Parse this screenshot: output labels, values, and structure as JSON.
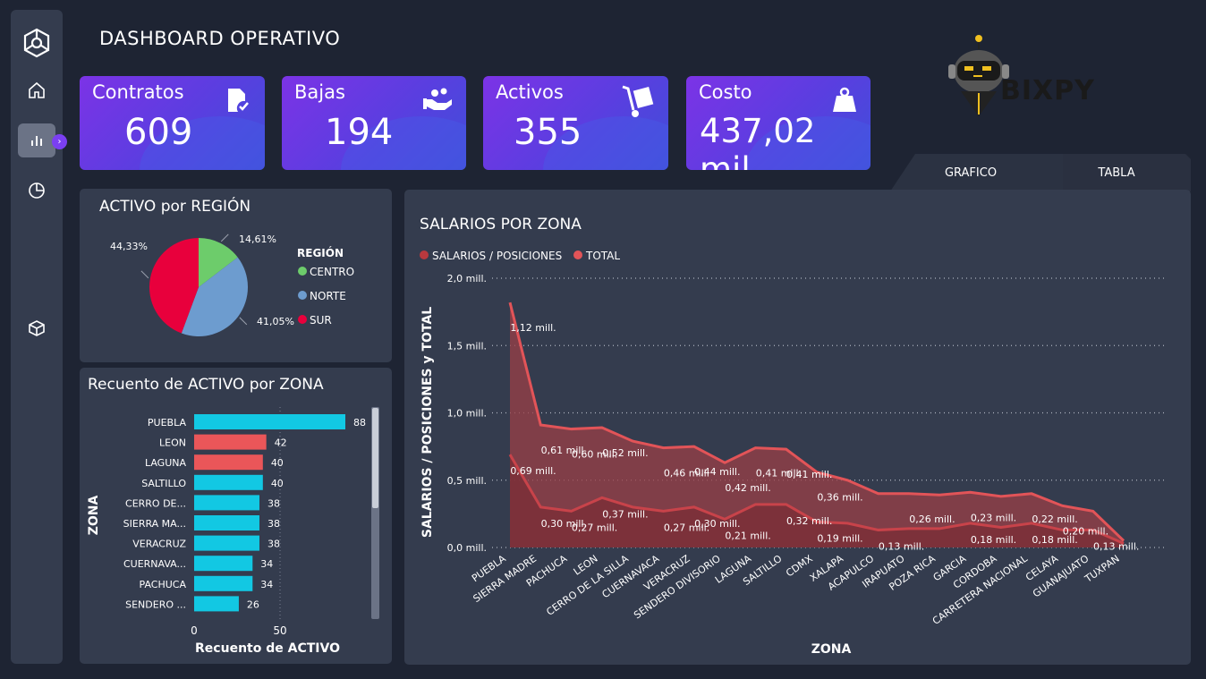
{
  "page_title": "DASHBOARD OPERATIVO",
  "sidebar": {
    "items": [
      {
        "icon": "logo-icon"
      },
      {
        "icon": "home-icon"
      },
      {
        "icon": "bar-chart-icon",
        "active": true
      },
      {
        "icon": "pie-chart-icon"
      },
      {
        "icon": "cube-icon"
      }
    ],
    "expand_icon": "›"
  },
  "kpis": [
    {
      "label": "Contratos",
      "value": "609",
      "icon": "contract-icon"
    },
    {
      "label": "Bajas",
      "value": "194",
      "icon": "handshake-icon"
    },
    {
      "label": "Activos",
      "value": "355",
      "icon": "hand-truck-icon"
    },
    {
      "label": "Costo",
      "value": "437,02 mil",
      "icon": "weight-bag-icon"
    }
  ],
  "logo": {
    "text": "BIXPY"
  },
  "tabs": [
    {
      "label": "GRAFICO",
      "active": true
    },
    {
      "label": "TABLA",
      "active": false
    }
  ],
  "colors": {
    "bg": "#1e2433",
    "card": "#343c4e",
    "accent": "#7b3ff2",
    "centro": "#6dcc6b",
    "norte": "#6d9ccf",
    "sur": "#e8003c",
    "bar_cyan": "#12c8e3",
    "bar_red": "#ea5659",
    "line": "#e25458"
  },
  "chart_data": [
    {
      "type": "pie",
      "title": "ACTIVO por REGIÓN",
      "legend_title": "REGIÓN",
      "legend_position": "right",
      "slices": [
        {
          "label": "CENTRO",
          "value": 14.61,
          "display": "14,61%"
        },
        {
          "label": "NORTE",
          "value": 41.05,
          "display": "41,05%"
        },
        {
          "label": "SUR",
          "value": 44.33,
          "display": "44,33%"
        }
      ]
    },
    {
      "type": "bar",
      "orientation": "horizontal",
      "title": "Recuento de ACTIVO por ZONA",
      "xlabel": "Recuento de ACTIVO",
      "ylabel": "ZONA",
      "xlim": [
        0,
        90
      ],
      "xticks": [
        "0",
        "50"
      ],
      "categories": [
        "PUEBLA",
        "LEON",
        "LAGUNA",
        "SALTILLO",
        "CERRO DE...",
        "SIERRA MA...",
        "VERACRUZ",
        "CUERNAVA...",
        "PACHUCA",
        "SENDERO ..."
      ],
      "values": [
        88,
        42,
        40,
        40,
        38,
        38,
        38,
        34,
        34,
        26
      ],
      "highlight": [
        false,
        true,
        true,
        false,
        false,
        false,
        false,
        false,
        false,
        false
      ]
    },
    {
      "type": "area",
      "title": "SALARIOS POR ZONA",
      "xlabel": "ZONA",
      "ylabel": "SALARIOS / POSICIONES y TOTAL",
      "legend_position": "top-left",
      "ylim": [
        0,
        2.0
      ],
      "yticks": [
        "0,0 mill.",
        "0,5 mill.",
        "1,0 mill.",
        "1,5 mill.",
        "2,0 mill."
      ],
      "grid": true,
      "categories": [
        "PUEBLA",
        "SIERRA MADRE",
        "PACHUCA",
        "LEON",
        "CERRO DE LA SILLA",
        "CUERNAVACA",
        "VERACRUZ",
        "SENDERO DIVISORIO",
        "LAGUNA",
        "SALTILLO",
        "CDMX",
        "XALAPA",
        "ACAPULCO",
        "IRAPUATO",
        "POZA RICA",
        "GARCIA",
        "CORDOBA",
        "CARRETERA NACIONAL",
        "CELAYA",
        "GUANAJUATO",
        "TUXPAN"
      ],
      "series": [
        {
          "name": "SALARIOS / POSICIONES",
          "values": [
            0.69,
            0.3,
            0.27,
            0.37,
            0.3,
            0.27,
            0.3,
            0.21,
            0.32,
            0.32,
            0.19,
            0.18,
            0.13,
            0.14,
            0.14,
            0.18,
            0.15,
            0.18,
            0.13,
            0.13,
            0.03
          ],
          "labels": [
            {
              "i": 0,
              "t": "0,69 mill."
            },
            {
              "i": 1,
              "t": "0,30 mill."
            },
            {
              "i": 2,
              "t": "0,27 mill."
            },
            {
              "i": 3,
              "t": "0,37 mill."
            },
            {
              "i": 5,
              "t": "0,27 mill."
            },
            {
              "i": 6,
              "t": "0,30 mill."
            },
            {
              "i": 7,
              "t": "0,21 mill."
            },
            {
              "i": 9,
              "t": "0,32 mill."
            },
            {
              "i": 10,
              "t": "0,19 mill."
            },
            {
              "i": 12,
              "t": "0,13 mill."
            },
            {
              "i": 15,
              "t": "0,18 mill."
            },
            {
              "i": 17,
              "t": "0,18 mill."
            },
            {
              "i": 19,
              "t": "0,13 mill."
            }
          ]
        },
        {
          "name": "TOTAL",
          "values": [
            1.82,
            0.91,
            0.88,
            0.89,
            0.79,
            0.74,
            0.75,
            0.63,
            0.74,
            0.73,
            0.56,
            0.5,
            0.4,
            0.4,
            0.39,
            0.41,
            0.38,
            0.4,
            0.31,
            0.27,
            0.05
          ],
          "labels": [
            {
              "i": 0,
              "t": "1,12 mill."
            },
            {
              "i": 1,
              "t": "0,61 mill."
            },
            {
              "i": 2,
              "t": "0,60 mill."
            },
            {
              "i": 3,
              "t": "0,52 mill."
            },
            {
              "i": 5,
              "t": "0,46 mill."
            },
            {
              "i": 6,
              "t": "0,44 mill."
            },
            {
              "i": 7,
              "t": "0,42 mill."
            },
            {
              "i": 8,
              "t": "0,41 mill."
            },
            {
              "i": 9,
              "t": "0,41 mill."
            },
            {
              "i": 10,
              "t": "0,36 mill."
            },
            {
              "i": 13,
              "t": "0,26 mill."
            },
            {
              "i": 15,
              "t": "0,23 mill."
            },
            {
              "i": 17,
              "t": "0,22 mill."
            },
            {
              "i": 18,
              "t": "0,20 mill."
            }
          ]
        }
      ]
    }
  ]
}
